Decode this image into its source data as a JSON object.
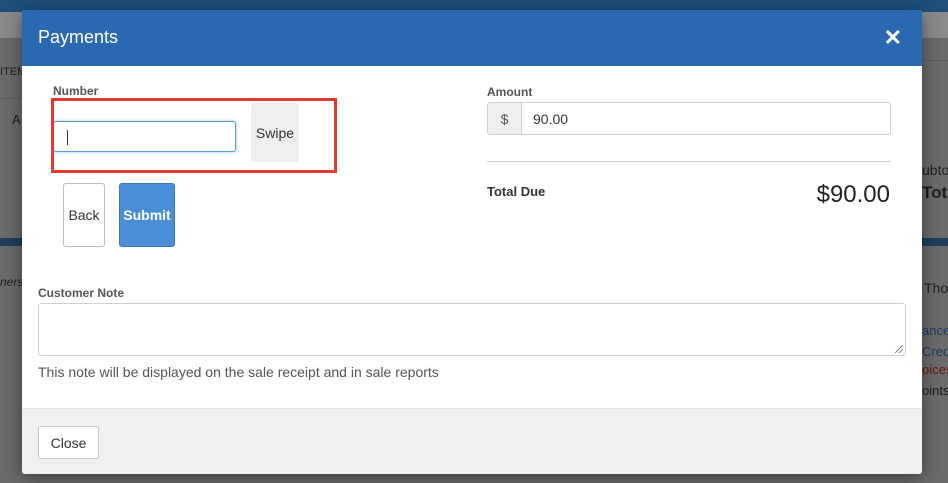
{
  "background": {
    "fragments": [
      "ubto",
      "Tot",
      "Tho",
      "ance",
      "Credi",
      "oices",
      "oints",
      "ITEM",
      "A",
      "ners"
    ]
  },
  "modal": {
    "title": "Payments",
    "close_icon": "close-icon"
  },
  "number": {
    "label": "Number",
    "value": "",
    "swipe_label": "Swipe"
  },
  "actions": {
    "back_label": "Back",
    "submit_label": "Submit"
  },
  "amount": {
    "label": "Amount",
    "currency_symbol": "$",
    "value": "90.00"
  },
  "total_due": {
    "label": "Total Due",
    "value": "$90.00"
  },
  "customer_note": {
    "label": "Customer Note",
    "value": "",
    "help_text": "This note will be displayed on the sale receipt and in sale reports"
  },
  "footer": {
    "close_label": "Close"
  },
  "colors": {
    "header": "#2a68b1",
    "submit": "#4a8fd6",
    "highlight": "#e53935"
  }
}
